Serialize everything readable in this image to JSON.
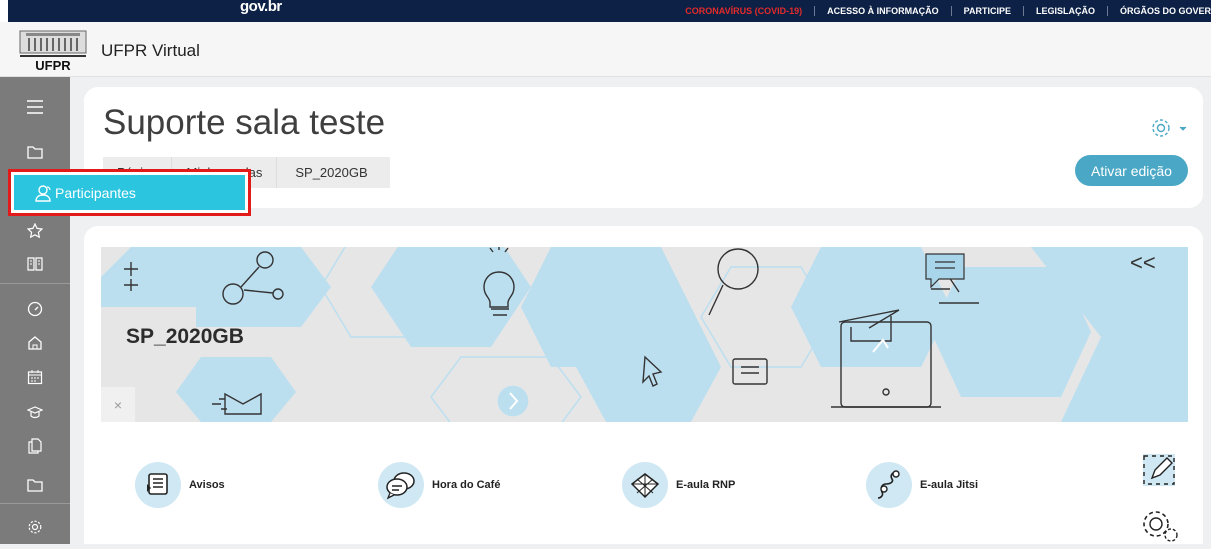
{
  "gov": {
    "logo": "gov.br",
    "links": [
      "CORONAVÍRUS (COVID-19)",
      "ACESSO À INFORMAÇÃO",
      "PARTICIPE",
      "LEGISLAÇÃO",
      "ÓRGÃOS DO GOVER"
    ]
  },
  "header": {
    "logo_text": "UFPR",
    "site_name": "UFPR Virtual"
  },
  "sidebar": {
    "icons": [
      "menu-icon",
      "folder-icon",
      "participants-icon",
      "star-icon",
      "book-icon",
      "dashboard-icon",
      "home-icon",
      "calendar-icon",
      "graduation-cap-icon",
      "files-icon",
      "folder-icon",
      "gear-icon"
    ]
  },
  "tooltip": {
    "label": "Participantes"
  },
  "course": {
    "title": "Suporte sala teste",
    "breadcrumb": [
      "Página",
      "Minhas salas",
      "SP_2020GB"
    ],
    "edit_button": "Ativar edição"
  },
  "banner": {
    "title": "SP_2020GB",
    "close": "×",
    "collapse": "<<"
  },
  "tiles": [
    {
      "label": "Avisos",
      "icon": "announcement-icon"
    },
    {
      "label": "Hora do Café",
      "icon": "chat-icon"
    },
    {
      "label": "E-aula RNP",
      "icon": "rnp-icon"
    },
    {
      "label": "E-aula Jitsi",
      "icon": "jitsi-icon"
    }
  ],
  "colors": {
    "accent": "#4aa7c5",
    "tooltip": "#2bc5e0",
    "highlight": "#e21a1a",
    "sidebar": "#7b7b7b"
  }
}
